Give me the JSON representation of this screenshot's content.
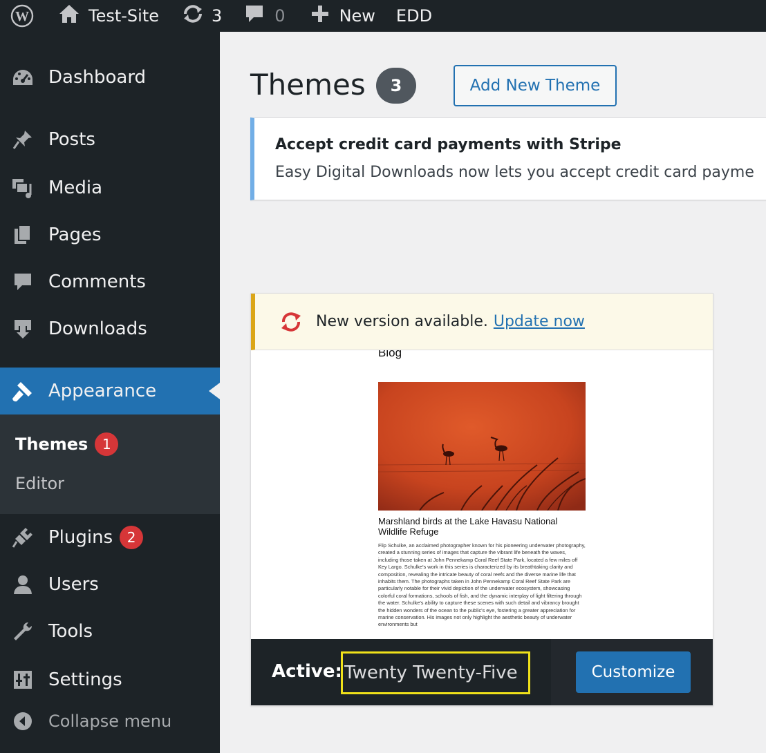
{
  "admin_bar": {
    "wp_logo_icon": "wordpress-icon",
    "site_name": "Test-Site",
    "updates_count": "3",
    "comments_count": "0",
    "new_label": "New",
    "edd_label": "EDD"
  },
  "sidebar": {
    "items": [
      {
        "label": "Dashboard",
        "icon": "dashboard-icon"
      },
      {
        "label": "Posts",
        "icon": "pin-icon"
      },
      {
        "label": "Media",
        "icon": "media-icon"
      },
      {
        "label": "Pages",
        "icon": "pages-icon"
      },
      {
        "label": "Comments",
        "icon": "comment-icon"
      },
      {
        "label": "Downloads",
        "icon": "download-icon"
      },
      {
        "label": "Appearance",
        "icon": "paintbrush-icon"
      },
      {
        "label": "Plugins",
        "icon": "plugin-icon",
        "badge": "2"
      },
      {
        "label": "Users",
        "icon": "user-icon"
      },
      {
        "label": "Tools",
        "icon": "wrench-icon"
      },
      {
        "label": "Settings",
        "icon": "settings-icon"
      }
    ],
    "submenu": [
      {
        "label": "Themes",
        "badge": "1"
      },
      {
        "label": "Editor"
      }
    ],
    "collapse_label": "Collapse menu"
  },
  "main": {
    "title": "Themes",
    "count": "3",
    "add_new_label": "Add New Theme",
    "notice": {
      "title": "Accept credit card payments with Stripe",
      "text": "Easy Digital Downloads now lets you accept credit card payme"
    },
    "theme": {
      "update_text": "New version available.",
      "update_link": "Update now",
      "preview": {
        "blog_heading": "Blog",
        "caption": "Marshland birds at the Lake Havasu National Wildlife Refuge",
        "body": "Flip Schulke, an acclaimed photographer known for his pioneering underwater photography, created a stunning series of images that capture the vibrant life beneath the waves, including those taken at John Pennekamp Coral Reef State Park, located a few miles off Key Largo. Schulke's work in this series is characterized by its breathtaking clarity and composition, revealing the intricate beauty of coral reefs and the diverse marine life that inhabits them. The photographs taken in John Pennekamp Coral Reef State Park are particularly notable for their vivid depiction of the underwater ecosystem, showcasing colorful coral formations, schools of fish, and the dynamic interplay of light filtering through the water. Schulke's ability to capture these scenes with such detail and vibrancy brought the hidden wonders of the ocean to the public's eye, fostering a greater appreciation for marine conservation. His images not only highlight the aesthetic beauty of underwater environments but"
      },
      "active_label": "Active:",
      "name": "Twenty Twenty-Five",
      "customize_label": "Customize"
    }
  },
  "colors": {
    "admin_dark": "#1d2327",
    "accent": "#2271b1",
    "badge_red": "#d63638",
    "highlight": "#f0e11a"
  }
}
